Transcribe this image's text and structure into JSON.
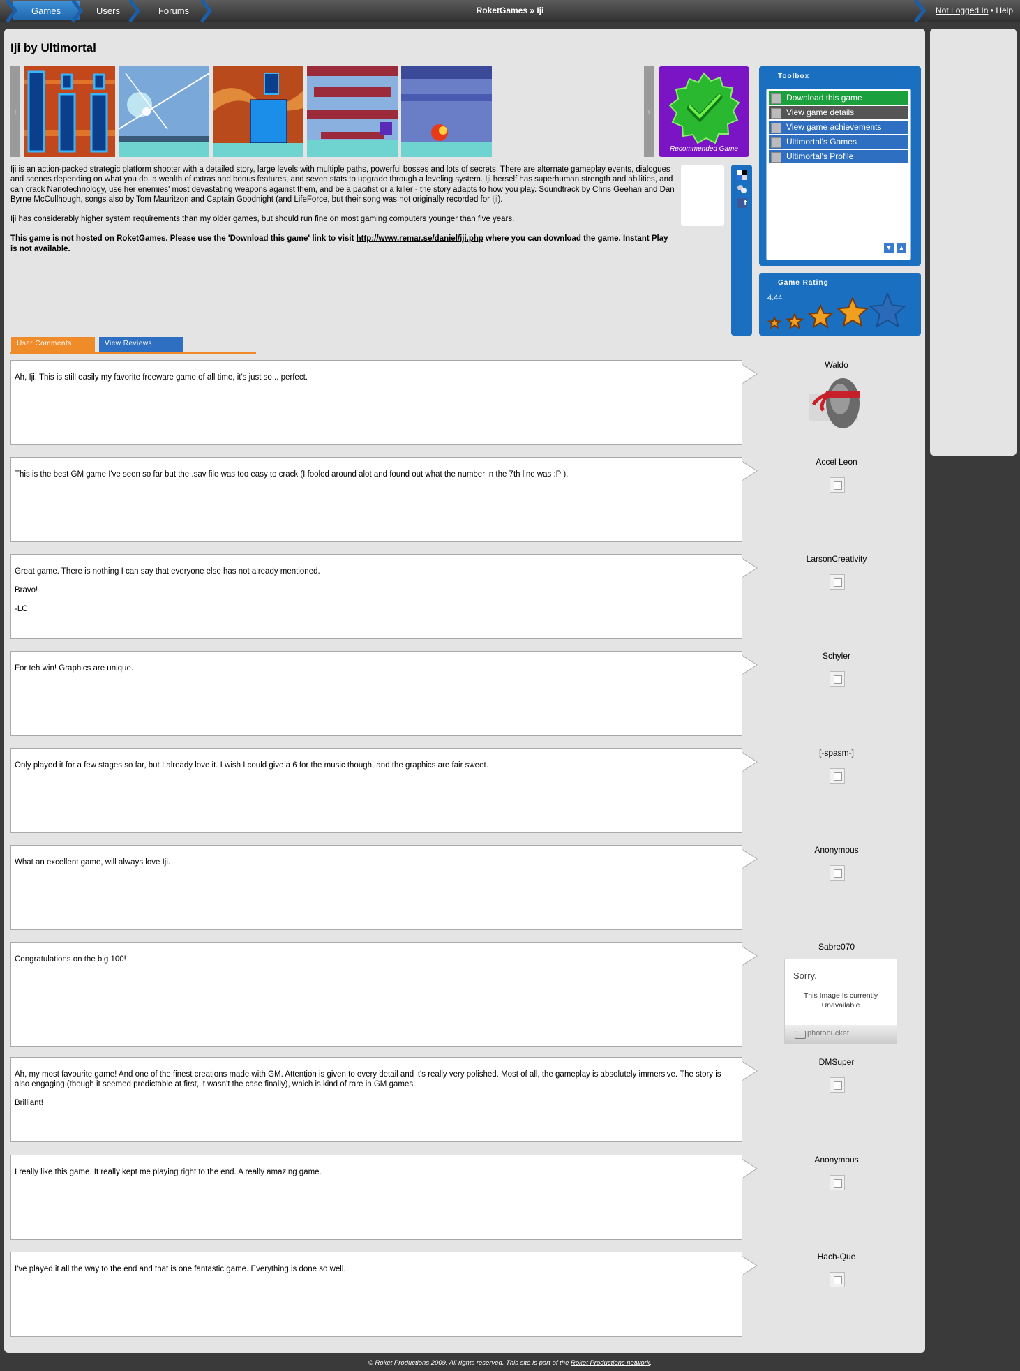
{
  "nav": {
    "tabs": [
      "Games",
      "Users",
      "Forums"
    ],
    "breadcrumb": "RoketGames » Iji",
    "login_label": "Not Logged In",
    "separator": "•",
    "help_label": "Help"
  },
  "game": {
    "title": "Iji by Ultimortal",
    "badge_label": "Recommended Game",
    "description": [
      "Iji is an action-packed strategic platform shooter with a detailed story, large levels with multiple paths, powerful bosses and lots of secrets. There are alternate gameplay events, dialogues and scenes depending on what you do, a wealth of extras and bonus features, and seven stats to upgrade through a leveling system. Iji herself has superhuman strength and abilities, and can crack Nanotechnology, use her enemies' most devastating weapons against them, and be a pacifist or a killer - the story adapts to how you play. Soundtrack by Chris Geehan and Dan Byrne McCullhough, songs also by Tom Mauritzon and Captain Goodnight (and LifeForce, but their song was not originally recorded for Iji).",
      "Iji has considerably higher system requirements than my older games, but should run fine on most gaming computers younger than five years."
    ],
    "hosting_note_pre": "This game is not hosted on RoketGames.  Please use the 'Download this game' link to visit ",
    "hosting_link": "http://www.remar.se/daniel/iji.php",
    "hosting_note_post": " where you can download the game.  Instant Play is not available."
  },
  "toolbox": {
    "title": "Toolbox",
    "items": [
      "Download this game",
      "View game details",
      "View game achievements",
      "Ultimortal's Games",
      "Ultimortal's Profile"
    ]
  },
  "rating": {
    "title": "Game Rating",
    "value": "4.44",
    "stars": 5
  },
  "tabs": [
    "User Comments",
    "View Reviews"
  ],
  "comments": [
    {
      "user": "Waldo",
      "paragraphs": [
        "Ah, Iji. This is still easily my favorite freeware game of all time, it's just so... perfect."
      ]
    },
    {
      "user": "Accel Leon",
      "paragraphs": [
        "This is the best GM game I've seen so far but the .sav file was too easy to crack (I fooled around alot and found out what the number in the 7th line was :P )."
      ]
    },
    {
      "user": "LarsonCreativity",
      "paragraphs": [
        "Great game.  There is nothing I can say that everyone else has not already mentioned.",
        "Bravo!",
        "-LC"
      ]
    },
    {
      "user": "Schyler",
      "paragraphs": [
        "For teh win! Graphics are unique."
      ]
    },
    {
      "user": "[-spasm-]",
      "paragraphs": [
        "Only played it for a few stages so far, but I already love it. I wish I could give a 6 for the music though, and the graphics are fair sweet."
      ]
    },
    {
      "user": "Anonymous",
      "paragraphs": [
        "What an excellent game, will always love Iji."
      ]
    },
    {
      "user": "Sabre070",
      "paragraphs": [
        "Congratulations on the big 100!"
      ]
    },
    {
      "user": "DMSuper",
      "paragraphs": [
        "Ah, my most favourite game! And one of the finest creations made with GM. Attention is given to every detail and it's really very polished. Most of all, the gameplay is absolutely immersive. The story is also engaging (though it seemed predictable at first, it wasn't the case finally), which is kind of rare in GM games.",
        "Brilliant!"
      ]
    },
    {
      "user": "Anonymous",
      "paragraphs": [
        "I really like this game. It really kept me playing right to the end. A really amazing game."
      ]
    },
    {
      "user": "Hach-Que",
      "paragraphs": [
        "I've played it all the way to the end and that is one fantastic game.  Everything is done so well."
      ]
    }
  ],
  "photobucket": {
    "sorry": "Sorry.",
    "line1": "This Image Is currently",
    "line2": "Unavailable",
    "brand": "photobucket"
  },
  "footer": {
    "pre": "© Roket Productions 2009. All rights reserved. This site is part of the ",
    "link": "Roket Productions network",
    "post": "."
  },
  "colors": {
    "accent": "#1a6fc0",
    "download": "#1aa03c",
    "details": "#555555",
    "badge": "#7a14c4",
    "tab_active": "#f08b2a"
  }
}
